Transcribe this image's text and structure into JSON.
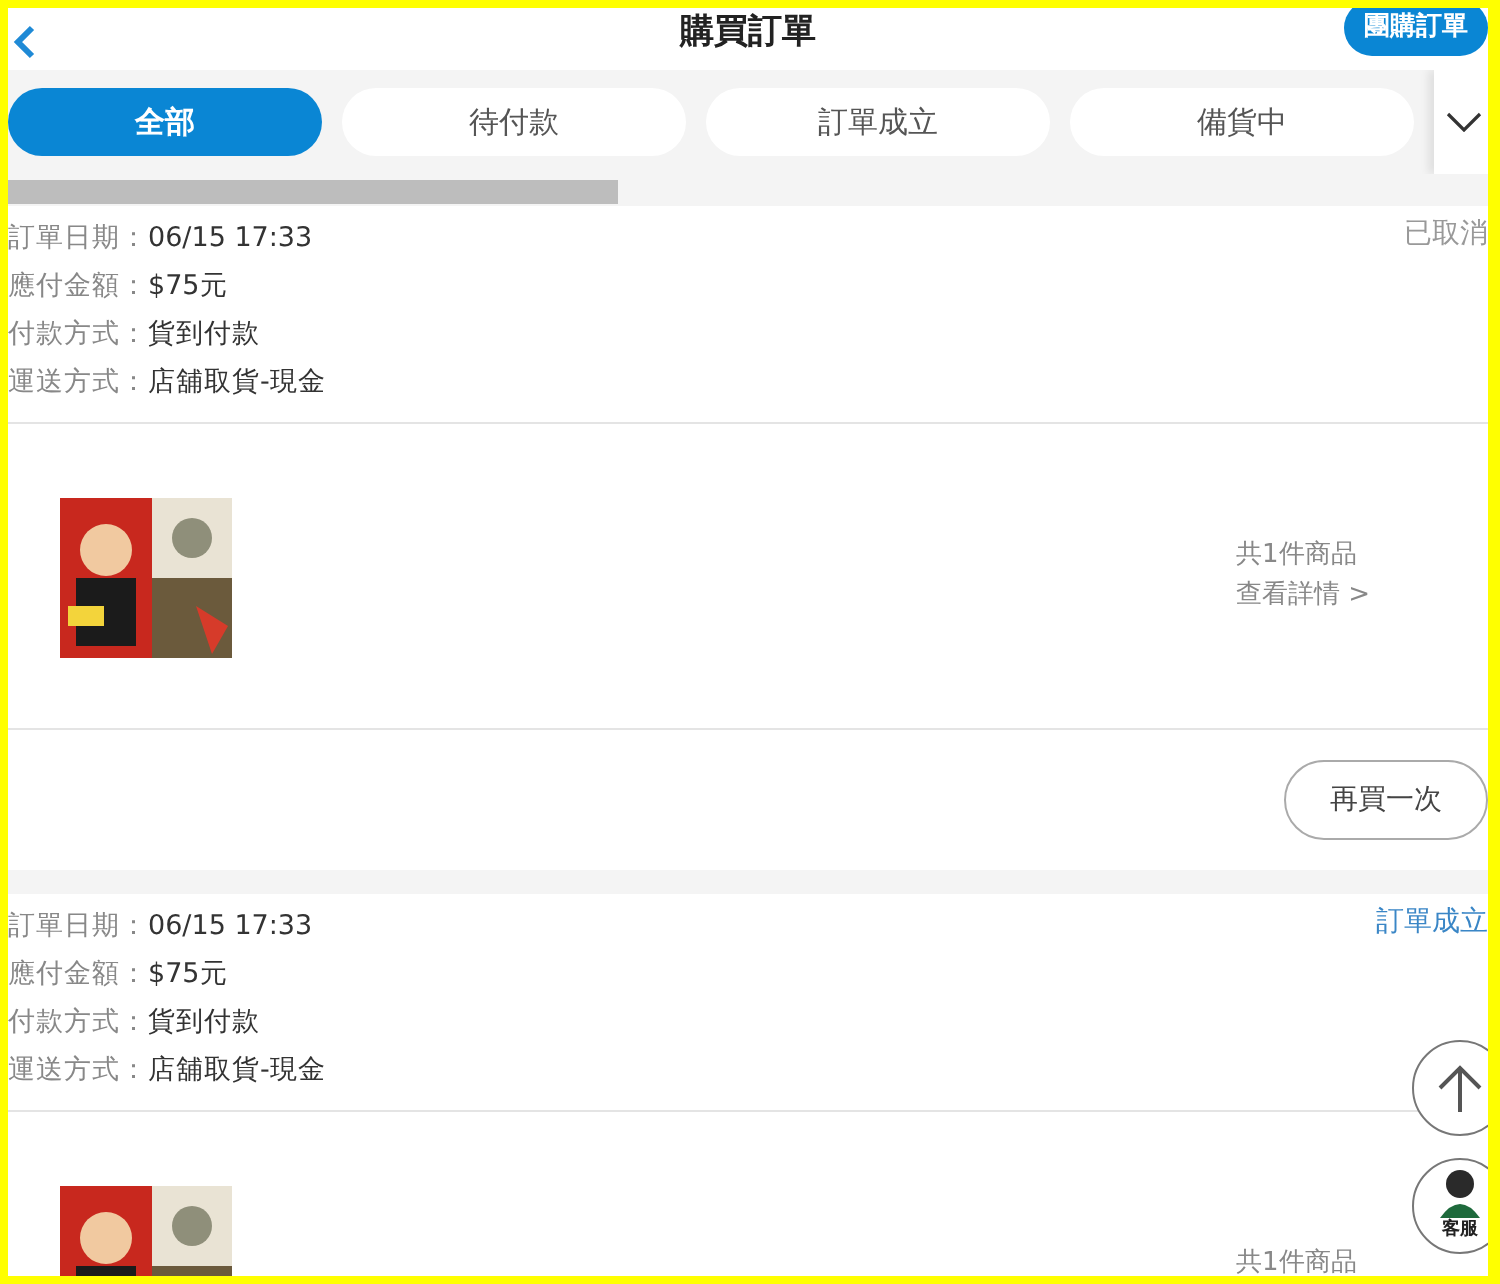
{
  "header": {
    "title": "購買訂單",
    "group_button": "團購訂單"
  },
  "tabs": [
    {
      "label": "全部",
      "selected": true
    },
    {
      "label": "待付款",
      "selected": false
    },
    {
      "label": "訂單成立",
      "selected": false
    },
    {
      "label": "備貨中",
      "selected": false
    }
  ],
  "orders": [
    {
      "status": {
        "label": "已取消",
        "color": "#999999"
      },
      "fields": [
        {
          "label": "訂單日期：",
          "value": "06/15 17:33"
        },
        {
          "label": "應付金額：",
          "value": "$75元"
        },
        {
          "label": "付款方式：",
          "value": "貨到付款"
        },
        {
          "label": "運送方式：",
          "value": "店舖取貨-現金"
        }
      ],
      "count": "共1件商品",
      "detail_link": "查看詳情 >",
      "action": "再買一次"
    },
    {
      "status": {
        "label": "訂單成立",
        "color": "#3a86c6"
      },
      "fields": [
        {
          "label": "訂單日期：",
          "value": "06/15 17:33"
        },
        {
          "label": "應付金額：",
          "value": "$75元"
        },
        {
          "label": "付款方式：",
          "value": "貨到付款"
        },
        {
          "label": "運送方式：",
          "value": "店舖取貨-現金"
        }
      ],
      "count": "共1件商品"
    }
  ],
  "service_button": "客服"
}
